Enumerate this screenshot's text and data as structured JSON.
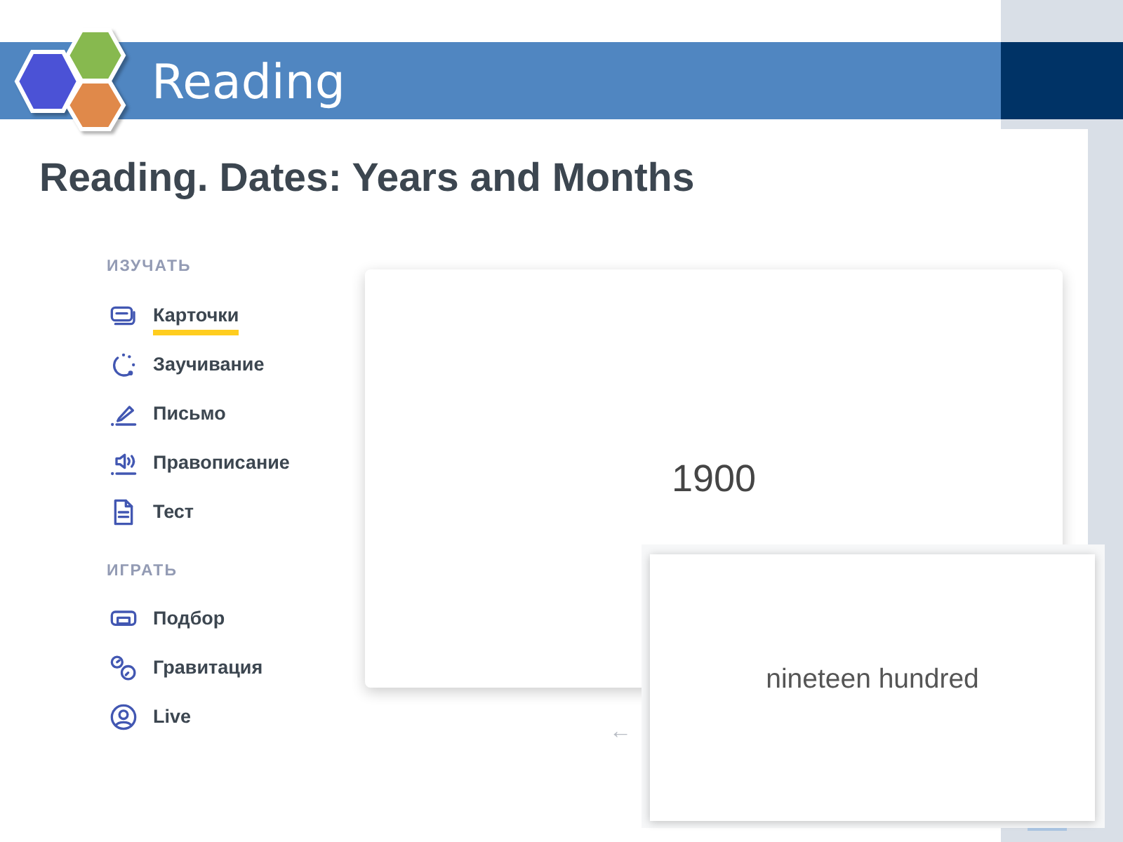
{
  "header": {
    "title": "Reading"
  },
  "page": {
    "title": "Reading. Dates: Years and Months"
  },
  "sidebar": {
    "sections": [
      {
        "label": "ИЗУЧАТЬ",
        "items": [
          {
            "label": "Карточки",
            "kind": "cards",
            "selected": true
          },
          {
            "label": "Заучивание",
            "kind": "learn",
            "selected": false
          },
          {
            "label": "Письмо",
            "kind": "write",
            "selected": false
          },
          {
            "label": "Правописание",
            "kind": "spell",
            "selected": false
          },
          {
            "label": "Тест",
            "kind": "test",
            "selected": false
          }
        ]
      },
      {
        "label": "ИГРАТЬ",
        "items": [
          {
            "label": "Подбор",
            "kind": "match",
            "selected": false
          },
          {
            "label": "Гравитация",
            "kind": "gravity",
            "selected": false
          },
          {
            "label": "Live",
            "kind": "live",
            "selected": false
          }
        ]
      }
    ]
  },
  "flashcard": {
    "term": "1900",
    "prev": "←"
  },
  "overlay_card": {
    "definition": "nineteen hundred"
  }
}
